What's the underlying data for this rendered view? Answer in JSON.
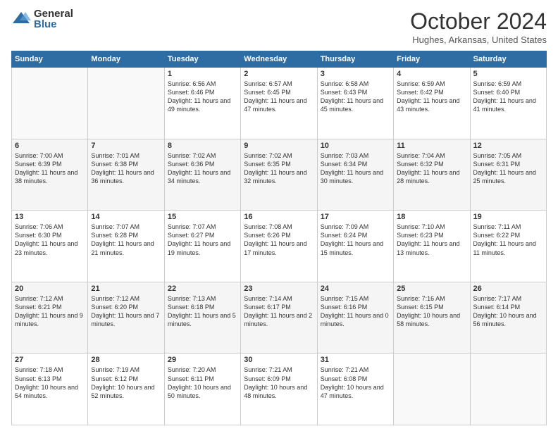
{
  "logo": {
    "general": "General",
    "blue": "Blue"
  },
  "header": {
    "month": "October 2024",
    "location": "Hughes, Arkansas, United States"
  },
  "weekdays": [
    "Sunday",
    "Monday",
    "Tuesday",
    "Wednesday",
    "Thursday",
    "Friday",
    "Saturday"
  ],
  "weeks": [
    [
      {
        "day": "",
        "info": ""
      },
      {
        "day": "",
        "info": ""
      },
      {
        "day": "1",
        "info": "Sunrise: 6:56 AM\nSunset: 6:46 PM\nDaylight: 11 hours and 49 minutes."
      },
      {
        "day": "2",
        "info": "Sunrise: 6:57 AM\nSunset: 6:45 PM\nDaylight: 11 hours and 47 minutes."
      },
      {
        "day": "3",
        "info": "Sunrise: 6:58 AM\nSunset: 6:43 PM\nDaylight: 11 hours and 45 minutes."
      },
      {
        "day": "4",
        "info": "Sunrise: 6:59 AM\nSunset: 6:42 PM\nDaylight: 11 hours and 43 minutes."
      },
      {
        "day": "5",
        "info": "Sunrise: 6:59 AM\nSunset: 6:40 PM\nDaylight: 11 hours and 41 minutes."
      }
    ],
    [
      {
        "day": "6",
        "info": "Sunrise: 7:00 AM\nSunset: 6:39 PM\nDaylight: 11 hours and 38 minutes."
      },
      {
        "day": "7",
        "info": "Sunrise: 7:01 AM\nSunset: 6:38 PM\nDaylight: 11 hours and 36 minutes."
      },
      {
        "day": "8",
        "info": "Sunrise: 7:02 AM\nSunset: 6:36 PM\nDaylight: 11 hours and 34 minutes."
      },
      {
        "day": "9",
        "info": "Sunrise: 7:02 AM\nSunset: 6:35 PM\nDaylight: 11 hours and 32 minutes."
      },
      {
        "day": "10",
        "info": "Sunrise: 7:03 AM\nSunset: 6:34 PM\nDaylight: 11 hours and 30 minutes."
      },
      {
        "day": "11",
        "info": "Sunrise: 7:04 AM\nSunset: 6:32 PM\nDaylight: 11 hours and 28 minutes."
      },
      {
        "day": "12",
        "info": "Sunrise: 7:05 AM\nSunset: 6:31 PM\nDaylight: 11 hours and 25 minutes."
      }
    ],
    [
      {
        "day": "13",
        "info": "Sunrise: 7:06 AM\nSunset: 6:30 PM\nDaylight: 11 hours and 23 minutes."
      },
      {
        "day": "14",
        "info": "Sunrise: 7:07 AM\nSunset: 6:28 PM\nDaylight: 11 hours and 21 minutes."
      },
      {
        "day": "15",
        "info": "Sunrise: 7:07 AM\nSunset: 6:27 PM\nDaylight: 11 hours and 19 minutes."
      },
      {
        "day": "16",
        "info": "Sunrise: 7:08 AM\nSunset: 6:26 PM\nDaylight: 11 hours and 17 minutes."
      },
      {
        "day": "17",
        "info": "Sunrise: 7:09 AM\nSunset: 6:24 PM\nDaylight: 11 hours and 15 minutes."
      },
      {
        "day": "18",
        "info": "Sunrise: 7:10 AM\nSunset: 6:23 PM\nDaylight: 11 hours and 13 minutes."
      },
      {
        "day": "19",
        "info": "Sunrise: 7:11 AM\nSunset: 6:22 PM\nDaylight: 11 hours and 11 minutes."
      }
    ],
    [
      {
        "day": "20",
        "info": "Sunrise: 7:12 AM\nSunset: 6:21 PM\nDaylight: 11 hours and 9 minutes."
      },
      {
        "day": "21",
        "info": "Sunrise: 7:12 AM\nSunset: 6:20 PM\nDaylight: 11 hours and 7 minutes."
      },
      {
        "day": "22",
        "info": "Sunrise: 7:13 AM\nSunset: 6:18 PM\nDaylight: 11 hours and 5 minutes."
      },
      {
        "day": "23",
        "info": "Sunrise: 7:14 AM\nSunset: 6:17 PM\nDaylight: 11 hours and 2 minutes."
      },
      {
        "day": "24",
        "info": "Sunrise: 7:15 AM\nSunset: 6:16 PM\nDaylight: 11 hours and 0 minutes."
      },
      {
        "day": "25",
        "info": "Sunrise: 7:16 AM\nSunset: 6:15 PM\nDaylight: 10 hours and 58 minutes."
      },
      {
        "day": "26",
        "info": "Sunrise: 7:17 AM\nSunset: 6:14 PM\nDaylight: 10 hours and 56 minutes."
      }
    ],
    [
      {
        "day": "27",
        "info": "Sunrise: 7:18 AM\nSunset: 6:13 PM\nDaylight: 10 hours and 54 minutes."
      },
      {
        "day": "28",
        "info": "Sunrise: 7:19 AM\nSunset: 6:12 PM\nDaylight: 10 hours and 52 minutes."
      },
      {
        "day": "29",
        "info": "Sunrise: 7:20 AM\nSunset: 6:11 PM\nDaylight: 10 hours and 50 minutes."
      },
      {
        "day": "30",
        "info": "Sunrise: 7:21 AM\nSunset: 6:09 PM\nDaylight: 10 hours and 48 minutes."
      },
      {
        "day": "31",
        "info": "Sunrise: 7:21 AM\nSunset: 6:08 PM\nDaylight: 10 hours and 47 minutes."
      },
      {
        "day": "",
        "info": ""
      },
      {
        "day": "",
        "info": ""
      }
    ]
  ]
}
